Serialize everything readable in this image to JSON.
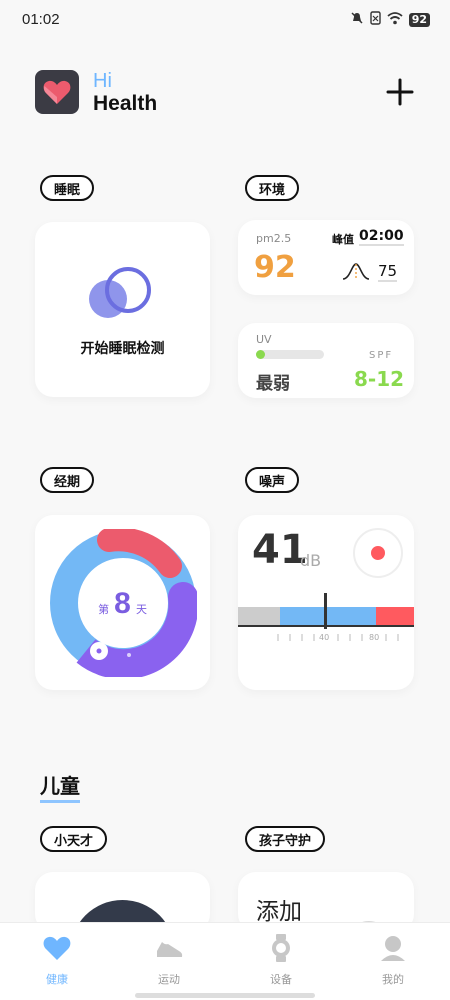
{
  "status_bar": {
    "time": "01:02",
    "battery": "92"
  },
  "brand": {
    "hi": "Hi",
    "health": "Health"
  },
  "sections": {
    "sleep": {
      "tag": "睡眠",
      "action": "开始睡眠检测"
    },
    "environment": {
      "tag": "环境",
      "pm_label": "pm2.5",
      "pm_value": "92",
      "peak_label": "峰值",
      "peak_time": "02:00",
      "peak_value": "75",
      "uv_label": "UV",
      "uv_level": "最弱",
      "spf_label": "SPF",
      "spf_value": "8-12"
    },
    "period": {
      "tag": "经期",
      "day_prefix": "第",
      "day_number": "8",
      "day_suffix": "天"
    },
    "noise": {
      "tag": "噪声",
      "value": "41",
      "unit": "dB",
      "scale_labels": [
        "40",
        "80"
      ],
      "pointer_level": 40
    },
    "children": {
      "title": "儿童",
      "tag_genius": "小天才",
      "tag_guard": "孩子守护",
      "add_label": "添加"
    }
  },
  "tabs": [
    {
      "label": "健康",
      "icon": "heart-icon",
      "active": true
    },
    {
      "label": "运动",
      "icon": "shoe-icon",
      "active": false
    },
    {
      "label": "设备",
      "icon": "watch-icon",
      "active": false
    },
    {
      "label": "我的",
      "icon": "person-icon",
      "active": false
    }
  ],
  "colors": {
    "accent_blue": "#6fb6ff",
    "pm_orange": "#f0a040",
    "spf_green": "#8ad94e",
    "period_red": "#ec5b6d",
    "period_purple": "#8a62ef",
    "period_blue": "#73b8f5",
    "noise_red": "#ff5a5f"
  }
}
